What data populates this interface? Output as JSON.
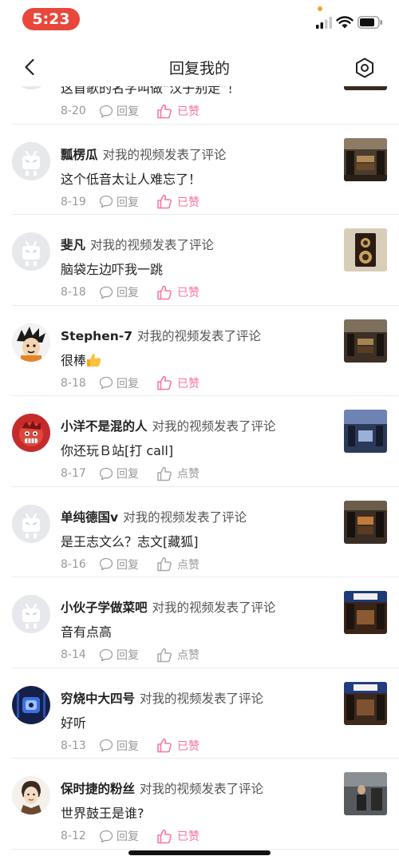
{
  "status": {
    "time": "5:23"
  },
  "nav": {
    "title": "回复我的"
  },
  "comments": [
    {
      "user": "",
      "action": "",
      "text": "这首歌的名字叫做“汉子别走”！",
      "date": "8-20",
      "reply": "回复",
      "like": "已赞",
      "liked": true
    },
    {
      "user": "瓢楞瓜",
      "action": "对我的视频发表了评论",
      "text": "这个低音太让人难忘了！",
      "date": "8-19",
      "reply": "回复",
      "like": "已赞",
      "liked": true
    },
    {
      "user": "斐凡",
      "action": "对我的视频发表了评论",
      "text": "脑袋左边吓我一跳",
      "date": "8-18",
      "reply": "回复",
      "like": "已赞",
      "liked": true
    },
    {
      "user": "Stephen-7",
      "action": "对我的视频发表了评论",
      "text": "很棒",
      "date": "8-18",
      "reply": "回复",
      "like": "已赞",
      "liked": true
    },
    {
      "user": "小洋不是混的人",
      "action": "对我的视频发表了评论",
      "text": "你还玩Ｂ站[打 call]",
      "date": "8-17",
      "reply": "回复",
      "like": "点赞",
      "liked": false
    },
    {
      "user": "单纯德国v",
      "action": "对我的视频发表了评论",
      "text": "是王志文么？志文[藏狐]",
      "date": "8-16",
      "reply": "回复",
      "like": "点赞",
      "liked": false
    },
    {
      "user": "小伙子学做菜吧",
      "action": "对我的视频发表了评论",
      "text": "音有点高",
      "date": "8-14",
      "reply": "回复",
      "like": "点赞",
      "liked": false
    },
    {
      "user": "穷烧中大四号",
      "action": "对我的视频发表了评论",
      "text": "好听",
      "date": "8-13",
      "reply": "回复",
      "like": "已赞",
      "liked": true
    },
    {
      "user": "保时捷的粉丝",
      "action": "对我的视频发表了评论",
      "text": "世界鼓王是谁?",
      "date": "8-12",
      "reply": "回复",
      "like": "已赞",
      "liked": true
    }
  ],
  "icons": {
    "back": "chevron-left-icon",
    "settings": "hexagon-settings-icon",
    "reply": "speech-bubble-icon",
    "like": "thumbs-up-icon",
    "emoji": "thumbs-up-emoji-icon"
  },
  "colors": {
    "accent": "#fb7299",
    "muted": "#999999",
    "time_pill": "#e8473a"
  }
}
